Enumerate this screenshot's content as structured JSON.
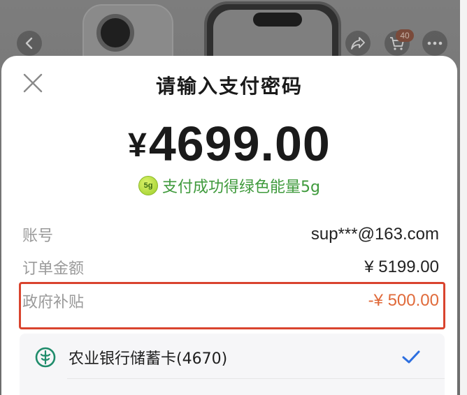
{
  "background": {
    "cart_badge": "40",
    "back_icon": "chevron-left-icon",
    "share_icon": "share-icon",
    "cart_icon": "cart-icon",
    "more_icon": "more-icon"
  },
  "sheet": {
    "title": "请输入支付密码",
    "close_icon": "close-icon",
    "amount_currency": "¥",
    "amount_value": "4699.00",
    "energy_badge": "5g",
    "energy_text": "支付成功得绿色能量5g",
    "energy_color": "#3f9a3c"
  },
  "details": [
    {
      "label": "账号",
      "value": "sup***@163.com"
    },
    {
      "label": "订单金额",
      "value": "¥ 5199.00"
    },
    {
      "label": "政府补贴",
      "value": "-¥ 500.00"
    }
  ],
  "payment": {
    "card_name": "农业银行储蓄卡(4670)",
    "bank_icon": "abc-bank-icon",
    "selected_icon": "checkmark-icon",
    "check_color": "#2d6fe0",
    "bank_color": "#1f8c6b"
  },
  "colors": {
    "subsidy_value": "#e06a3a",
    "highlight_border": "#d9442e"
  }
}
